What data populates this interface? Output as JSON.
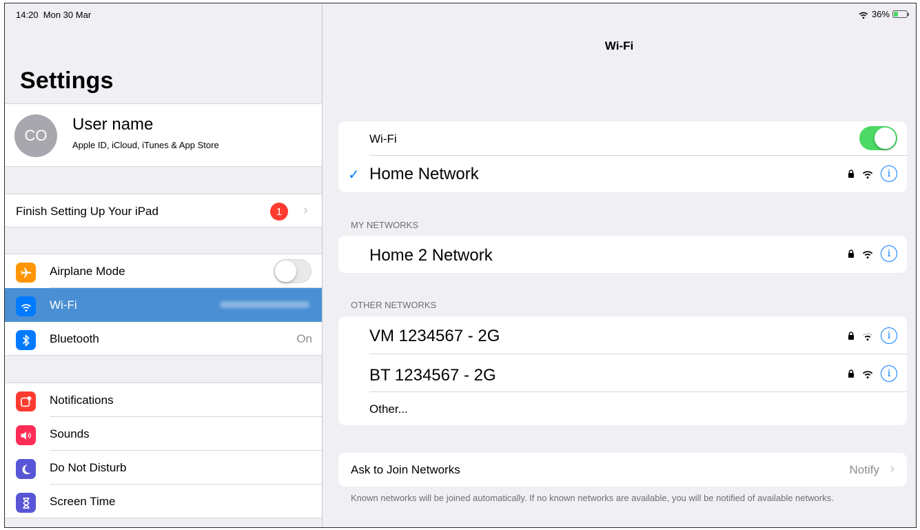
{
  "status_bar": {
    "time": "14:20",
    "date": "Mon 30 Mar",
    "battery": "36%",
    "battery_level": 0.36
  },
  "sidebar": {
    "title": "Settings",
    "profile": {
      "initials": "CO",
      "name": "User name",
      "subtitle": "Apple ID, iCloud, iTunes & App Store"
    },
    "finish_setup": {
      "label": "Finish Setting Up Your iPad",
      "badge": "1"
    },
    "items": [
      {
        "label": "Airplane Mode",
        "icon": "airplane-icon",
        "color": "#ff9500",
        "toggle_on": false
      },
      {
        "label": "Wi-Fi",
        "icon": "wifi-icon",
        "color": "#007aff",
        "selected": true
      },
      {
        "label": "Bluetooth",
        "icon": "bluetooth-icon",
        "color": "#007aff",
        "value": "On"
      },
      {
        "label": "Notifications",
        "icon": "notifications-icon",
        "color": "#ff3b30"
      },
      {
        "label": "Sounds",
        "icon": "speaker-icon",
        "color": "#ff2d55"
      },
      {
        "label": "Do Not Disturb",
        "icon": "moon-icon",
        "color": "#5856d6"
      },
      {
        "label": "Screen Time",
        "icon": "hourglass-icon",
        "color": "#5856d6"
      }
    ]
  },
  "wifi_pane": {
    "title": "Wi-Fi",
    "wifi_toggle_label": "Wi-Fi",
    "wifi_on": true,
    "connected_network": "Home Network",
    "my_networks_header": "MY NETWORKS",
    "my_networks": [
      "Home 2 Network"
    ],
    "other_networks_header": "OTHER NETWORKS",
    "other_networks": [
      "VM 1234567 - 2G",
      "BT 1234567 - 2G"
    ],
    "other_label": "Other...",
    "ask_to_join": {
      "label": "Ask to Join Networks",
      "value": "Notify"
    },
    "footer_note": "Known networks will be joined automatically. If no known networks are available, you will be notified of available networks.",
    "accent_color": "#007aff"
  }
}
